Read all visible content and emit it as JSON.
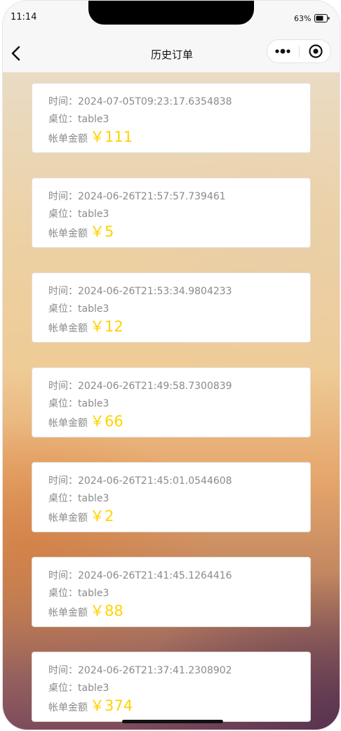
{
  "status_bar": {
    "time": "11:14",
    "battery_percent": "63%"
  },
  "nav": {
    "title": "历史订单",
    "back_icon": "chevron-left-icon",
    "more_icon": "more-dots-icon",
    "close_icon": "target-circle-icon"
  },
  "orders": [
    {
      "time_label": "时间：",
      "time": "2024-07-05T09:23:17.6354838",
      "table_label": "桌位：",
      "table": "table3",
      "amount_label": "帐单金额",
      "amount": "￥111"
    },
    {
      "time_label": "时间：",
      "time": "2024-06-26T21:57:57.739461",
      "table_label": "桌位：",
      "table": "table3",
      "amount_label": "帐单金额",
      "amount": "￥5"
    },
    {
      "time_label": "时间：",
      "time": "2024-06-26T21:53:34.9804233",
      "table_label": "桌位：",
      "table": "table3",
      "amount_label": "帐单金额",
      "amount": "￥12"
    },
    {
      "time_label": "时间：",
      "time": "2024-06-26T21:49:58.7300839",
      "table_label": "桌位：",
      "table": "table3",
      "amount_label": "帐单金额",
      "amount": "￥66"
    },
    {
      "time_label": "时间：",
      "time": "2024-06-26T21:45:01.0544608",
      "table_label": "桌位：",
      "table": "table3",
      "amount_label": "帐单金额",
      "amount": "￥2"
    },
    {
      "time_label": "时间：",
      "time": "2024-06-26T21:41:45.1264416",
      "table_label": "桌位：",
      "table": "table3",
      "amount_label": "帐单金额",
      "amount": "￥88"
    },
    {
      "time_label": "时间：",
      "time": "2024-06-26T21:37:41.2308902",
      "table_label": "桌位：",
      "table": "table3",
      "amount_label": "帐单金额",
      "amount": "￥374"
    }
  ],
  "colors": {
    "amount": "#ffd200",
    "text": "#8a8a8a",
    "card": "#ffffff"
  }
}
